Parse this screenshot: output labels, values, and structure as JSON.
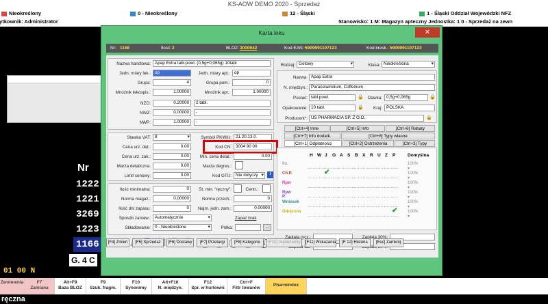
{
  "window": {
    "title": "KS-AOW DEMO 2020 - Sprzedaż"
  },
  "infobar": {
    "items": [
      {
        "id": "a",
        "text": "Nieokreślony"
      },
      {
        "id": "b",
        "text": "0 - Nieokreślony"
      },
      {
        "id": "c",
        "text": "12 - Śląski"
      },
      {
        "id": "d",
        "text": "1 - Śląski Oddział Wojewódzki NFZ"
      }
    ],
    "user": "Użytkownik: Administrator",
    "station": "Stanowisko: 1  M: Magazyn apteczny  Jednostka: 1  0 - Sprzedaż na zewn"
  },
  "background": {
    "nr_label": "Nr",
    "rows": [
      "1222",
      "1221",
      "3269",
      "1223",
      "1166"
    ],
    "g4": "G. 4 C",
    "legend": "01  00  N",
    "bottom_text": "ręczna"
  },
  "fkeys": [
    {
      "key": "",
      "label": "Zwolnienia"
    },
    {
      "key": "F7",
      "label": "Zamiana"
    },
    {
      "key": "Alt+F9",
      "label": "Baza BLOZ"
    },
    {
      "key": "F9",
      "label": "Szuk. fragm."
    },
    {
      "key": "F10",
      "label": "Synonimy"
    },
    {
      "key": "Alt+F10",
      "label": "N. międzyn."
    },
    {
      "key": "F12",
      "label": "Spr. w hurtowni"
    },
    {
      "key": "Ctrl+F",
      "label": "Filtr towarów"
    },
    {
      "key": "",
      "label": "Pharmindex"
    }
  ],
  "dialog": {
    "title": "Karta leku",
    "close": "✕",
    "header": {
      "nr_label": "Nr:",
      "nr": "1166",
      "ilosc_label": "Ilość:",
      "ilosc": "2",
      "bloz_label": "BLOZ:",
      "bloz": "3000942",
      "ean_label": "Kod EAN:",
      "ean": "5909991107123",
      "kreski_label": "Kod kresk.:",
      "kreski": "5909991107123"
    },
    "left": {
      "nazwa_handlowa_label": "Nazwa handlowa:",
      "nazwa_handlowa": "Apap Extra tabl.powl. (0,5g+0,065g) 10tabl",
      "jedn_miary_label": "Jedn. miary lek.:",
      "jedn_miary": "op",
      "jedn_miary_apt_label": "Jedn. miary apt.:",
      "jedn_miary_apt": "op",
      "grupa_label": "Grupa:",
      "grupa": "4",
      "grupa_pom_label": "Grupa pom.:",
      "grupa_pom": "0",
      "mnoznik_lekospis_label": "Mnożnik lekospis.:",
      "mnoznik_lekospis": "1.00000",
      "mnoznik_apt_label": "Mnożnik apt.:",
      "mnoznik_apt": "1.00000",
      "nzo_label": "NZO:",
      "nzo": "0.20000",
      "nzo_txt": "2 tabl.",
      "nwz_label": "NWZ:",
      "nwz": "0.00000",
      "nwz_txt": "-",
      "nwp_label": "NWP:",
      "nwp": "1.00000",
      "nwp_txt": "-",
      "stawka_vat_label": "Stawka VAT:",
      "stawka_vat": "8",
      "symbol_pkwiu_label": "Symbol PKWiU:",
      "symbol_pkwiu": "21.20.13.0",
      "cena_det_label": "Cena urz. det.:",
      "cena_det": "0.00",
      "kod_cn_label": "Kod CN:",
      "kod_cn": "3004 90 00",
      "cena_zak_label": "Cena urz. zak.:",
      "cena_zak": "0.00",
      "min_cena_label": "Min. cena detal.:",
      "min_cena": "0.00",
      "marza_det_label": "Marża detaliczna:",
      "marza_det": "0.00",
      "marza_degres_label": "Marża degres.:",
      "limit_label": "Limit cenowy:",
      "limit": "0.00",
      "kod_gtu_label": "Kod GTU:",
      "kod_gtu": "Nie dotyczy",
      "ilosc_min_label": "Ilość minimalna:",
      "ilosc_min": "0",
      "st_min_label": "St. min. \"ręczny\":",
      "centr_label": "Centr.:",
      "norma_mag_label": "Norma magaz.:",
      "norma_mag": "0.00000",
      "norma_prz_label": "Norma przech.:",
      "norma_prz": "0",
      "ilosc_zapasu_label": "Ilość dni zapasu:",
      "ilosc_zapasu": "0",
      "najm_jedn_label": "Najm. jedn. zam.:",
      "najm_jedn": "0.00000",
      "sposob_label": "Sposób zamaw.:",
      "sposob": "Automatycznie",
      "zapasc_label": "Zapać brak",
      "skladowanie_label": "Składowanie:",
      "skladowanie": "0 - Nieokreślone",
      "polka_label": "Półka:"
    },
    "right": {
      "rodzaj_label": "Rodzaj:",
      "rodzaj": "Gotowy",
      "klasa_label": "Klasa:",
      "klasa": "Nieokreślona",
      "nazwa_label": "Nazwa:",
      "nazwa": "Apap Extra",
      "n_miedzyn_label": "N. międzyn.:",
      "n_miedzyn": "Paracetamolum, Coffeinum",
      "postac_label": "Postać:",
      "postac": "tabl.powl.",
      "dawka_label": "Dawka:",
      "dawka": "0,5g+0,065g",
      "opakowanie_label": "Opakowanie:",
      "opakowanie": "10 tabl.",
      "kraj_label": "Kraj:",
      "kraj": "POLSKA",
      "producent_label": "Producent*:",
      "producent": "US PHARMACIA SP. Z O.O.",
      "tabs": [
        "[Ctrl+4] Inne",
        "[Ctrl+5] Info",
        "[Ctrl+6] Rabaty",
        "[Ctrl+7] Info dodatk.",
        "[Ctrl+8] Typy własne",
        "[Ctrl+1] Odpłatności",
        "[Ctrl+2] Ostrzeżenia",
        "[Ctrl+3] Typy"
      ],
      "grid_cols": [
        "H",
        "W",
        "J",
        "O",
        "A",
        "S",
        "B",
        "X",
        "R",
        "U",
        "Z",
        "P"
      ],
      "domyslna_label": "Domyślna",
      "rows": [
        {
          "label": "Ilu.",
          "color": "#9999aa",
          "pct": "100%"
        },
        {
          "label": "Ch.P.",
          "color": "#c0392b",
          "pct": "100%"
        },
        {
          "label": "Rpw",
          "color": "#d62fb0",
          "pct": "100%"
        },
        {
          "label": "Rpw P.",
          "color": "#7b3fc4",
          "pct": "100%"
        },
        {
          "label": "Wniosek",
          "color": "#2b8f8f",
          "pct": "100%"
        },
        {
          "label": "Odręczna",
          "color": "#c8b400",
          "pct": "100%"
        }
      ],
      "zaplata_rycz_label": "Zapłata rycz.:",
      "zaplata_bz_label": "Zapłata BZ:",
      "zaplata_30_label": "Zapłata 30%:",
      "zaplata_50_label": "Zapłata 50%:"
    },
    "letters": [
      "A",
      "B",
      "N",
      "P",
      "R"
    ],
    "buttons": [
      {
        "label": "[F4] Zmień",
        "dis": false
      },
      {
        "label": "[F5] Sprzedaż",
        "dis": false
      },
      {
        "label": "[F6] Dostawy",
        "dis": false
      },
      {
        "label": "[F7] Przetargi",
        "dis": false
      },
      {
        "label": "[F8] Kategorie",
        "dis": false
      },
      {
        "label": "[F10] Suplementy",
        "dis": true
      },
      {
        "label": "[F11] Wskazania",
        "dis": false
      },
      {
        "label": "[F 12] Historia",
        "dis": false
      },
      {
        "label": "[Esc] Zamknij",
        "dis": false
      }
    ]
  }
}
